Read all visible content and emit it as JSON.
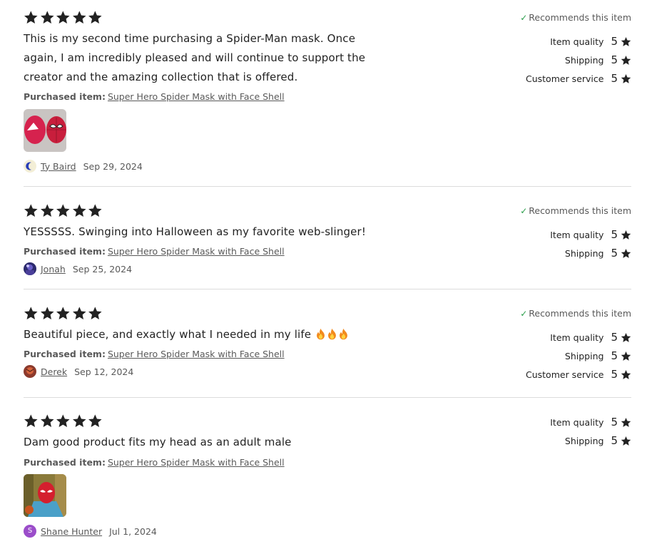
{
  "reviews": [
    {
      "rating": 5,
      "text": "This is my second time purchasing a Spider-Man mask. Once again, I am incredibly pleased and will continue to support the creator and the amazing collection that is offered.",
      "purchased_label": "Purchased item:",
      "item": "Super Hero Spider Mask with Face Shell",
      "author": "Ty Baird",
      "date": "Sep 29, 2024",
      "recommends": "Recommends this item",
      "ratings": [
        {
          "label": "Item quality",
          "value": "5"
        },
        {
          "label": "Shipping",
          "value": "5"
        },
        {
          "label": "Customer service",
          "value": "5"
        }
      ]
    },
    {
      "rating": 5,
      "text": "YESSSSS. Swinging into Halloween as my favorite web-slinger!",
      "purchased_label": "Purchased item:",
      "item": "Super Hero Spider Mask with Face Shell",
      "author": "Jonah",
      "date": "Sep 25, 2024",
      "recommends": "Recommends this item",
      "ratings": [
        {
          "label": "Item quality",
          "value": "5"
        },
        {
          "label": "Shipping",
          "value": "5"
        }
      ]
    },
    {
      "rating": 5,
      "text": "Beautiful piece, and exactly what I needed in my life",
      "emoji_icon": "fire-emoji-icon",
      "purchased_label": "Purchased item:",
      "item": "Super Hero Spider Mask with Face Shell",
      "author": "Derek",
      "date": "Sep 12, 2024",
      "recommends": "Recommends this item",
      "ratings": [
        {
          "label": "Item quality",
          "value": "5"
        },
        {
          "label": "Shipping",
          "value": "5"
        },
        {
          "label": "Customer service",
          "value": "5"
        }
      ]
    },
    {
      "rating": 5,
      "text": "Dam good product fits my head as an adult male",
      "purchased_label": "Purchased item:",
      "item": "Super Hero Spider Mask with Face Shell",
      "author": "Shane Hunter",
      "author_initial": "S",
      "date": "Jul 1, 2024",
      "ratings": [
        {
          "label": "Item quality",
          "value": "5"
        },
        {
          "label": "Shipping",
          "value": "5"
        }
      ]
    }
  ],
  "colors": {
    "text": "#222222",
    "muted": "#595959",
    "check": "#2a9d4a",
    "divider": "#dcdcdc",
    "avatar_purple": "#9b4dca"
  }
}
